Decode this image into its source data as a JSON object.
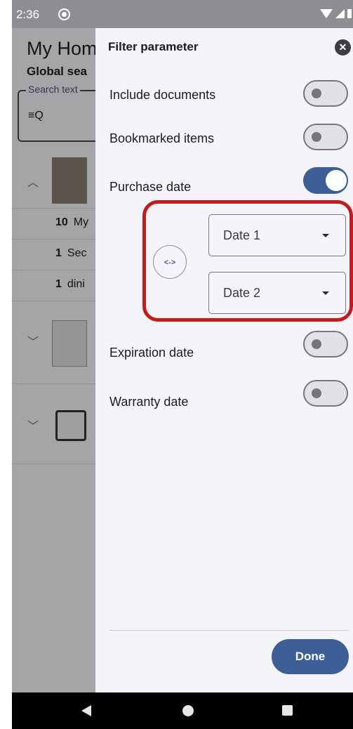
{
  "status_bar": {
    "time": "2:36"
  },
  "background": {
    "title": "My Hom",
    "subtitle": "Global sea",
    "search_label": "Search text",
    "search_icon": "≡Q",
    "rows": [
      {
        "count": "10",
        "text": "My"
      },
      {
        "count": "1",
        "text": "Sec"
      },
      {
        "count": "1",
        "text": "dini"
      }
    ]
  },
  "dialog": {
    "title": "Filter parameter",
    "close_icon": "✕",
    "options": {
      "include_documents": {
        "label": "Include documents",
        "checked": false
      },
      "bookmarked_items": {
        "label": "Bookmarked items",
        "checked": false
      },
      "purchase_date": {
        "label": "Purchase date",
        "checked": true
      },
      "expiration_date": {
        "label": "Expiration date",
        "checked": false
      },
      "warranty_date": {
        "label": "Warranty date",
        "checked": false
      }
    },
    "swap_label": "<->",
    "date1": "Date 1",
    "date2": "Date 2",
    "done": "Done",
    "highlight_color": "#c21c1c",
    "accent_color": "#3e5e97"
  }
}
